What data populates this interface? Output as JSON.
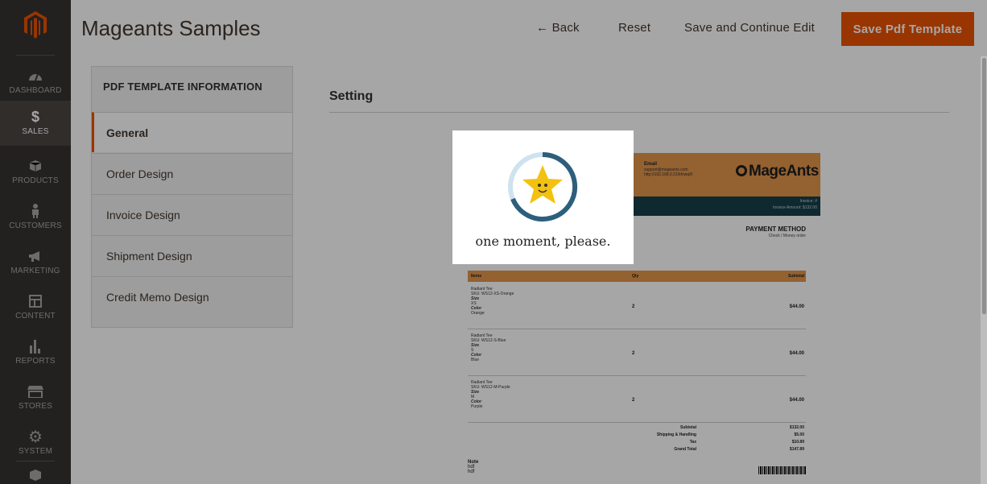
{
  "app": {
    "title": "Mageants Samples"
  },
  "sidebar": {
    "items": [
      {
        "label": "DASHBOARD",
        "icon": "dashboard-icon"
      },
      {
        "label": "SALES",
        "icon": "dollar-icon",
        "active": true
      },
      {
        "label": "PRODUCTS",
        "icon": "cube-icon"
      },
      {
        "label": "CUSTOMERS",
        "icon": "person-icon"
      },
      {
        "label": "MARKETING",
        "icon": "megaphone-icon"
      },
      {
        "label": "CONTENT",
        "icon": "layout-icon"
      },
      {
        "label": "REPORTS",
        "icon": "bar-chart-icon"
      },
      {
        "label": "STORES",
        "icon": "storefront-icon"
      },
      {
        "label": "SYSTEM",
        "icon": "gear-icon"
      }
    ]
  },
  "header": {
    "back_label": "← Back",
    "reset_label": "Reset",
    "save_continue_label": "Save and Continue Edit",
    "save_label": "Save Pdf Template"
  },
  "tabs": {
    "title": "PDF TEMPLATE INFORMATION",
    "items": [
      {
        "label": "General",
        "active": true
      },
      {
        "label": "Order Design"
      },
      {
        "label": "Invoice Design"
      },
      {
        "label": "Shipment Design"
      },
      {
        "label": "Credit Memo Design"
      }
    ]
  },
  "section": {
    "title": "Setting"
  },
  "pdf": {
    "email_label": "Email",
    "email_text": "support@mageants.com http://192.168.0.21/kfnwq9/",
    "brand": "MageAnts",
    "invoice_line1": "Invoice: #",
    "invoice_line2": "Invoice Amount: $132.00",
    "payment_method": "PAYMENT METHOD",
    "payment_value": "Check / Money order",
    "columns": [
      "Items",
      "Qty",
      "Subtotal"
    ],
    "rows": [
      {
        "name": "Radiant Tee",
        "sku": "SKU: WS12-XS-Orange",
        "size": "XS",
        "color": "Orange",
        "qty": "2",
        "subtotal": "$44.00"
      },
      {
        "name": "Radiant Tee",
        "sku": "SKU: WS12-S-Blue",
        "size": "S",
        "color": "Blue",
        "qty": "2",
        "subtotal": "$44.00"
      },
      {
        "name": "Radiant Tee",
        "sku": "SKU: WS12-M-Purple",
        "size": "M",
        "color": "Purple",
        "qty": "2",
        "subtotal": "$44.00"
      }
    ],
    "size_label": "Size",
    "color_label": "Color",
    "totals": [
      {
        "label": "Subtotal",
        "value": "$132.00"
      },
      {
        "label": "Shipping & Handling",
        "value": "$5.00"
      },
      {
        "label": "Tax",
        "value": "$10.89"
      },
      {
        "label": "Grand Total",
        "value": "$147.89"
      }
    ],
    "note_label": "Note",
    "note_lines": [
      "hdf",
      "hdf"
    ]
  },
  "loader": {
    "text": "one moment, please."
  },
  "colors": {
    "accent": "#eb5202",
    "sidebar": "#373330",
    "pdf_orange": "#e3954b",
    "pdf_dark": "#163f4a"
  }
}
